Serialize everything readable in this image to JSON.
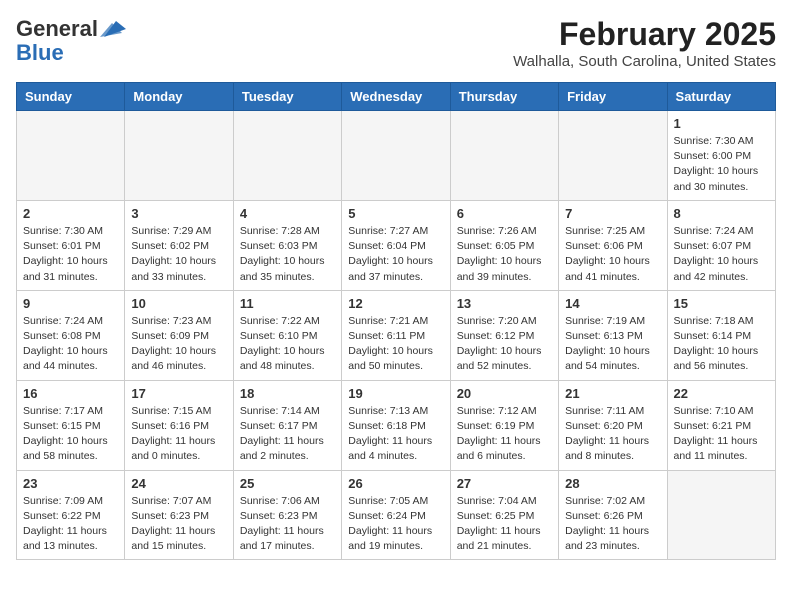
{
  "header": {
    "logo_general": "General",
    "logo_blue": "Blue",
    "month_year": "February 2025",
    "location": "Walhalla, South Carolina, United States"
  },
  "days_of_week": [
    "Sunday",
    "Monday",
    "Tuesday",
    "Wednesday",
    "Thursday",
    "Friday",
    "Saturday"
  ],
  "weeks": [
    [
      {
        "num": "",
        "info": ""
      },
      {
        "num": "",
        "info": ""
      },
      {
        "num": "",
        "info": ""
      },
      {
        "num": "",
        "info": ""
      },
      {
        "num": "",
        "info": ""
      },
      {
        "num": "",
        "info": ""
      },
      {
        "num": "1",
        "info": "Sunrise: 7:30 AM\nSunset: 6:00 PM\nDaylight: 10 hours and 30 minutes."
      }
    ],
    [
      {
        "num": "2",
        "info": "Sunrise: 7:30 AM\nSunset: 6:01 PM\nDaylight: 10 hours and 31 minutes."
      },
      {
        "num": "3",
        "info": "Sunrise: 7:29 AM\nSunset: 6:02 PM\nDaylight: 10 hours and 33 minutes."
      },
      {
        "num": "4",
        "info": "Sunrise: 7:28 AM\nSunset: 6:03 PM\nDaylight: 10 hours and 35 minutes."
      },
      {
        "num": "5",
        "info": "Sunrise: 7:27 AM\nSunset: 6:04 PM\nDaylight: 10 hours and 37 minutes."
      },
      {
        "num": "6",
        "info": "Sunrise: 7:26 AM\nSunset: 6:05 PM\nDaylight: 10 hours and 39 minutes."
      },
      {
        "num": "7",
        "info": "Sunrise: 7:25 AM\nSunset: 6:06 PM\nDaylight: 10 hours and 41 minutes."
      },
      {
        "num": "8",
        "info": "Sunrise: 7:24 AM\nSunset: 6:07 PM\nDaylight: 10 hours and 42 minutes."
      }
    ],
    [
      {
        "num": "9",
        "info": "Sunrise: 7:24 AM\nSunset: 6:08 PM\nDaylight: 10 hours and 44 minutes."
      },
      {
        "num": "10",
        "info": "Sunrise: 7:23 AM\nSunset: 6:09 PM\nDaylight: 10 hours and 46 minutes."
      },
      {
        "num": "11",
        "info": "Sunrise: 7:22 AM\nSunset: 6:10 PM\nDaylight: 10 hours and 48 minutes."
      },
      {
        "num": "12",
        "info": "Sunrise: 7:21 AM\nSunset: 6:11 PM\nDaylight: 10 hours and 50 minutes."
      },
      {
        "num": "13",
        "info": "Sunrise: 7:20 AM\nSunset: 6:12 PM\nDaylight: 10 hours and 52 minutes."
      },
      {
        "num": "14",
        "info": "Sunrise: 7:19 AM\nSunset: 6:13 PM\nDaylight: 10 hours and 54 minutes."
      },
      {
        "num": "15",
        "info": "Sunrise: 7:18 AM\nSunset: 6:14 PM\nDaylight: 10 hours and 56 minutes."
      }
    ],
    [
      {
        "num": "16",
        "info": "Sunrise: 7:17 AM\nSunset: 6:15 PM\nDaylight: 10 hours and 58 minutes."
      },
      {
        "num": "17",
        "info": "Sunrise: 7:15 AM\nSunset: 6:16 PM\nDaylight: 11 hours and 0 minutes."
      },
      {
        "num": "18",
        "info": "Sunrise: 7:14 AM\nSunset: 6:17 PM\nDaylight: 11 hours and 2 minutes."
      },
      {
        "num": "19",
        "info": "Sunrise: 7:13 AM\nSunset: 6:18 PM\nDaylight: 11 hours and 4 minutes."
      },
      {
        "num": "20",
        "info": "Sunrise: 7:12 AM\nSunset: 6:19 PM\nDaylight: 11 hours and 6 minutes."
      },
      {
        "num": "21",
        "info": "Sunrise: 7:11 AM\nSunset: 6:20 PM\nDaylight: 11 hours and 8 minutes."
      },
      {
        "num": "22",
        "info": "Sunrise: 7:10 AM\nSunset: 6:21 PM\nDaylight: 11 hours and 11 minutes."
      }
    ],
    [
      {
        "num": "23",
        "info": "Sunrise: 7:09 AM\nSunset: 6:22 PM\nDaylight: 11 hours and 13 minutes."
      },
      {
        "num": "24",
        "info": "Sunrise: 7:07 AM\nSunset: 6:23 PM\nDaylight: 11 hours and 15 minutes."
      },
      {
        "num": "25",
        "info": "Sunrise: 7:06 AM\nSunset: 6:23 PM\nDaylight: 11 hours and 17 minutes."
      },
      {
        "num": "26",
        "info": "Sunrise: 7:05 AM\nSunset: 6:24 PM\nDaylight: 11 hours and 19 minutes."
      },
      {
        "num": "27",
        "info": "Sunrise: 7:04 AM\nSunset: 6:25 PM\nDaylight: 11 hours and 21 minutes."
      },
      {
        "num": "28",
        "info": "Sunrise: 7:02 AM\nSunset: 6:26 PM\nDaylight: 11 hours and 23 minutes."
      },
      {
        "num": "",
        "info": ""
      }
    ]
  ]
}
